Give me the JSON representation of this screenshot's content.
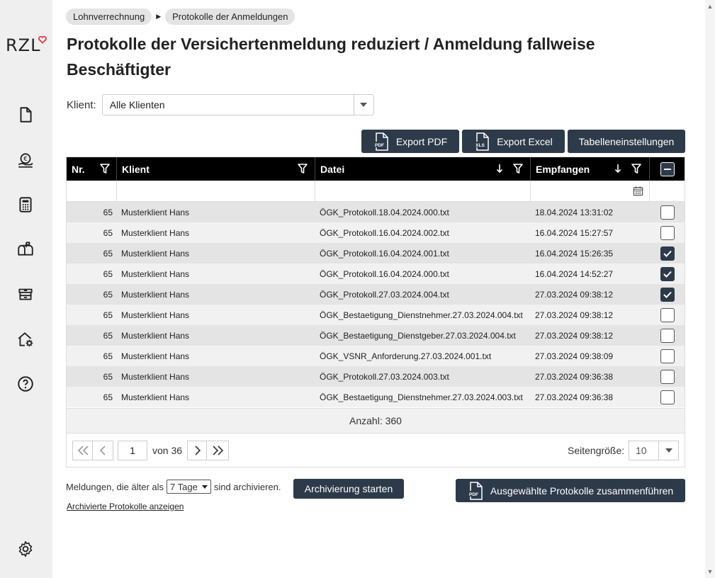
{
  "sidebar": {
    "logo_text": "RZL",
    "brand_color": "#e63946",
    "icons": [
      "document-icon",
      "euro-coin-hand-icon",
      "calculator-icon",
      "mailbox-icon",
      "archive-box-icon",
      "home-gear-icon",
      "help-icon",
      "settings-gear-icon"
    ]
  },
  "breadcrumb": [
    "Lohnverrechnung",
    "Protokolle der Anmeldungen"
  ],
  "title": "Protokolle der Versichertenmeldung reduziert / Anmeldung fallweise Beschäftigter",
  "client": {
    "label": "Klient:",
    "value": "Alle Klienten"
  },
  "toolbar": {
    "export_pdf": "Export PDF",
    "export_excel": "Export Excel",
    "table_settings": "Tabelleneinstellungen",
    "pdf_badge": "PDF",
    "xls_badge": "XLS"
  },
  "table": {
    "columns": [
      "Nr.",
      "Klient",
      "Datei",
      "Empfangen"
    ],
    "rows": [
      {
        "nr": "65",
        "klient": "Musterklient Hans",
        "datei": "ÖGK_Protokoll.18.04.2024.000.txt",
        "empfangen": "18.04.2024 13:31:02",
        "checked": false
      },
      {
        "nr": "65",
        "klient": "Musterklient Hans",
        "datei": "ÖGK_Protokoll.16.04.2024.002.txt",
        "empfangen": "16.04.2024 15:27:57",
        "checked": false
      },
      {
        "nr": "65",
        "klient": "Musterklient Hans",
        "datei": "ÖGK_Protokoll.16.04.2024.001.txt",
        "empfangen": "16.04.2024 15:26:35",
        "checked": true
      },
      {
        "nr": "65",
        "klient": "Musterklient Hans",
        "datei": "ÖGK_Protokoll.16.04.2024.000.txt",
        "empfangen": "16.04.2024 14:52:27",
        "checked": true
      },
      {
        "nr": "65",
        "klient": "Musterklient Hans",
        "datei": "ÖGK_Protokoll.27.03.2024.004.txt",
        "empfangen": "27.03.2024 09:38:12",
        "checked": true
      },
      {
        "nr": "65",
        "klient": "Musterklient Hans",
        "datei": "ÖGK_Bestaetigung_Dienstnehmer.27.03.2024.004.txt",
        "empfangen": "27.03.2024 09:38:12",
        "checked": false
      },
      {
        "nr": "65",
        "klient": "Musterklient Hans",
        "datei": "ÖGK_Bestaetigung_Dienstgeber.27.03.2024.004.txt",
        "empfangen": "27.03.2024 09:38:12",
        "checked": false
      },
      {
        "nr": "65",
        "klient": "Musterklient Hans",
        "datei": "ÖGK_VSNR_Anforderung.27.03.2024.001.txt",
        "empfangen": "27.03.2024 09:38:09",
        "checked": false
      },
      {
        "nr": "65",
        "klient": "Musterklient Hans",
        "datei": "ÖGK_Protokoll.27.03.2024.003.txt",
        "empfangen": "27.03.2024 09:36:38",
        "checked": false
      },
      {
        "nr": "65",
        "klient": "Musterklient Hans",
        "datei": "ÖGK_Bestaetigung_Dienstnehmer.27.03.2024.003.txt",
        "empfangen": "27.03.2024 09:36:38",
        "checked": false
      }
    ],
    "count_text": "Anzahl: 360"
  },
  "pager": {
    "page": "1",
    "of_text": "von 36",
    "size_label": "Seitengröße:",
    "size_value": "10"
  },
  "archive": {
    "prefix": "Meldungen, die älter als",
    "days": "7 Tage",
    "suffix": "sind archivieren.",
    "start_button": "Archivierung starten",
    "merge_button": "Ausgewählte Protokolle zusammenführen",
    "archived_link": "Archivierte Protokolle anzeigen"
  }
}
